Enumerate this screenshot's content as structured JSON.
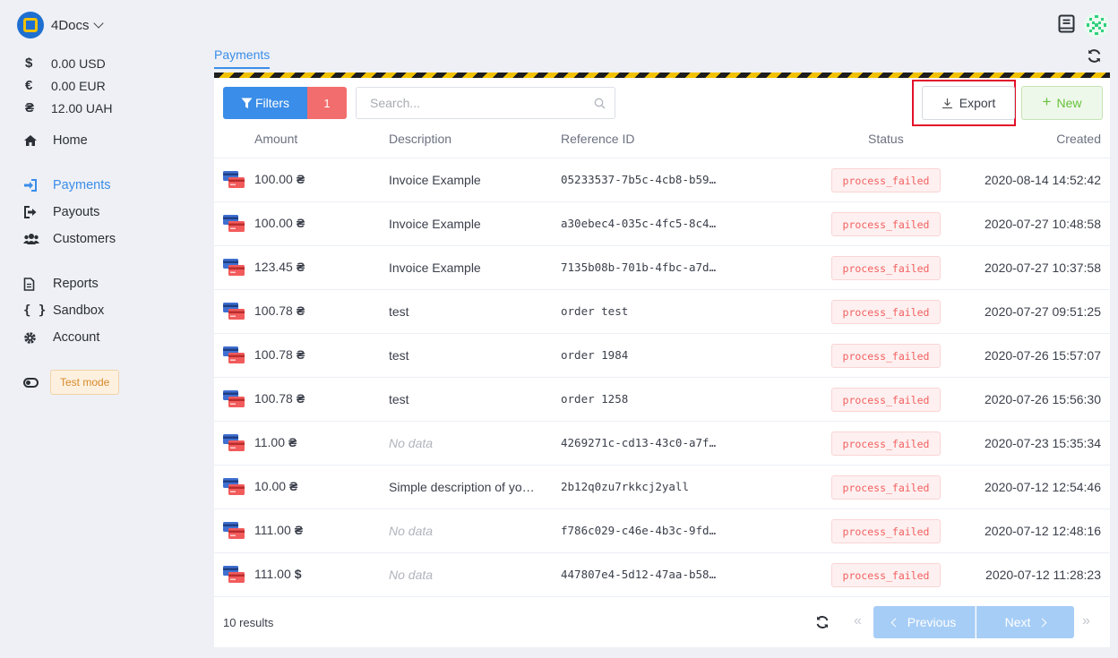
{
  "brand": {
    "name": "4Docs"
  },
  "balances": [
    {
      "symbol": "$",
      "value": "0.00 USD"
    },
    {
      "symbol": "€",
      "value": "0.00 EUR"
    },
    {
      "symbol": "₴",
      "value": "12.00 UAH"
    }
  ],
  "nav": {
    "home": "Home",
    "payments": "Payments",
    "payouts": "Payouts",
    "customers": "Customers",
    "reports": "Reports",
    "sandbox": "Sandbox",
    "account": "Account"
  },
  "test_mode": {
    "label": "Test mode"
  },
  "tab": {
    "label": "Payments"
  },
  "toolbar": {
    "filters_label": "Filters",
    "filter_count": "1",
    "search_placeholder": "Search...",
    "export_label": "Export",
    "new_label": "New"
  },
  "table": {
    "headers": {
      "amount": "Amount",
      "description": "Description",
      "reference": "Reference ID",
      "status": "Status",
      "created": "Created"
    },
    "rows": [
      {
        "amount": "100.00",
        "currency": "₴",
        "description": "Invoice Example",
        "nodata": false,
        "reference": "05233537-7b5c-4cb8-b59…",
        "status": "process_failed",
        "created": "2020-08-14 14:52:42"
      },
      {
        "amount": "100.00",
        "currency": "₴",
        "description": "Invoice Example",
        "nodata": false,
        "reference": "a30ebec4-035c-4fc5-8c4…",
        "status": "process_failed",
        "created": "2020-07-27 10:48:58"
      },
      {
        "amount": "123.45",
        "currency": "₴",
        "description": "Invoice Example",
        "nodata": false,
        "reference": "7135b08b-701b-4fbc-a7d…",
        "status": "process_failed",
        "created": "2020-07-27 10:37:58"
      },
      {
        "amount": "100.78",
        "currency": "₴",
        "description": "test",
        "nodata": false,
        "reference": "order test",
        "status": "process_failed",
        "created": "2020-07-27 09:51:25"
      },
      {
        "amount": "100.78",
        "currency": "₴",
        "description": "test",
        "nodata": false,
        "reference": "order 1984",
        "status": "process_failed",
        "created": "2020-07-26 15:57:07"
      },
      {
        "amount": "100.78",
        "currency": "₴",
        "description": "test",
        "nodata": false,
        "reference": "order 1258",
        "status": "process_failed",
        "created": "2020-07-26 15:56:30"
      },
      {
        "amount": "11.00",
        "currency": "₴",
        "description": "No data",
        "nodata": true,
        "reference": "4269271c-cd13-43c0-a7f…",
        "status": "process_failed",
        "created": "2020-07-23 15:35:34"
      },
      {
        "amount": "10.00",
        "currency": "₴",
        "description": "Simple description of yo…",
        "nodata": false,
        "reference": "2b12q0zu7rkkcj2yall",
        "status": "process_failed",
        "created": "2020-07-12 12:54:46"
      },
      {
        "amount": "111.00",
        "currency": "₴",
        "description": "No data",
        "nodata": true,
        "reference": "f786c029-c46e-4b3c-9fd…",
        "status": "process_failed",
        "created": "2020-07-12 12:48:16"
      },
      {
        "amount": "111.00",
        "currency": "$",
        "description": "No data",
        "nodata": true,
        "reference": "447807e4-5d12-47aa-b58…",
        "status": "process_failed",
        "created": "2020-07-12 11:28:23"
      }
    ]
  },
  "pagination": {
    "results": "10 results",
    "previous": "Previous",
    "next": "Next"
  },
  "colors": {
    "accent": "#3a8de8",
    "danger": "#f26d6d",
    "success": "#67c23a",
    "highlight": "#e3102a"
  }
}
